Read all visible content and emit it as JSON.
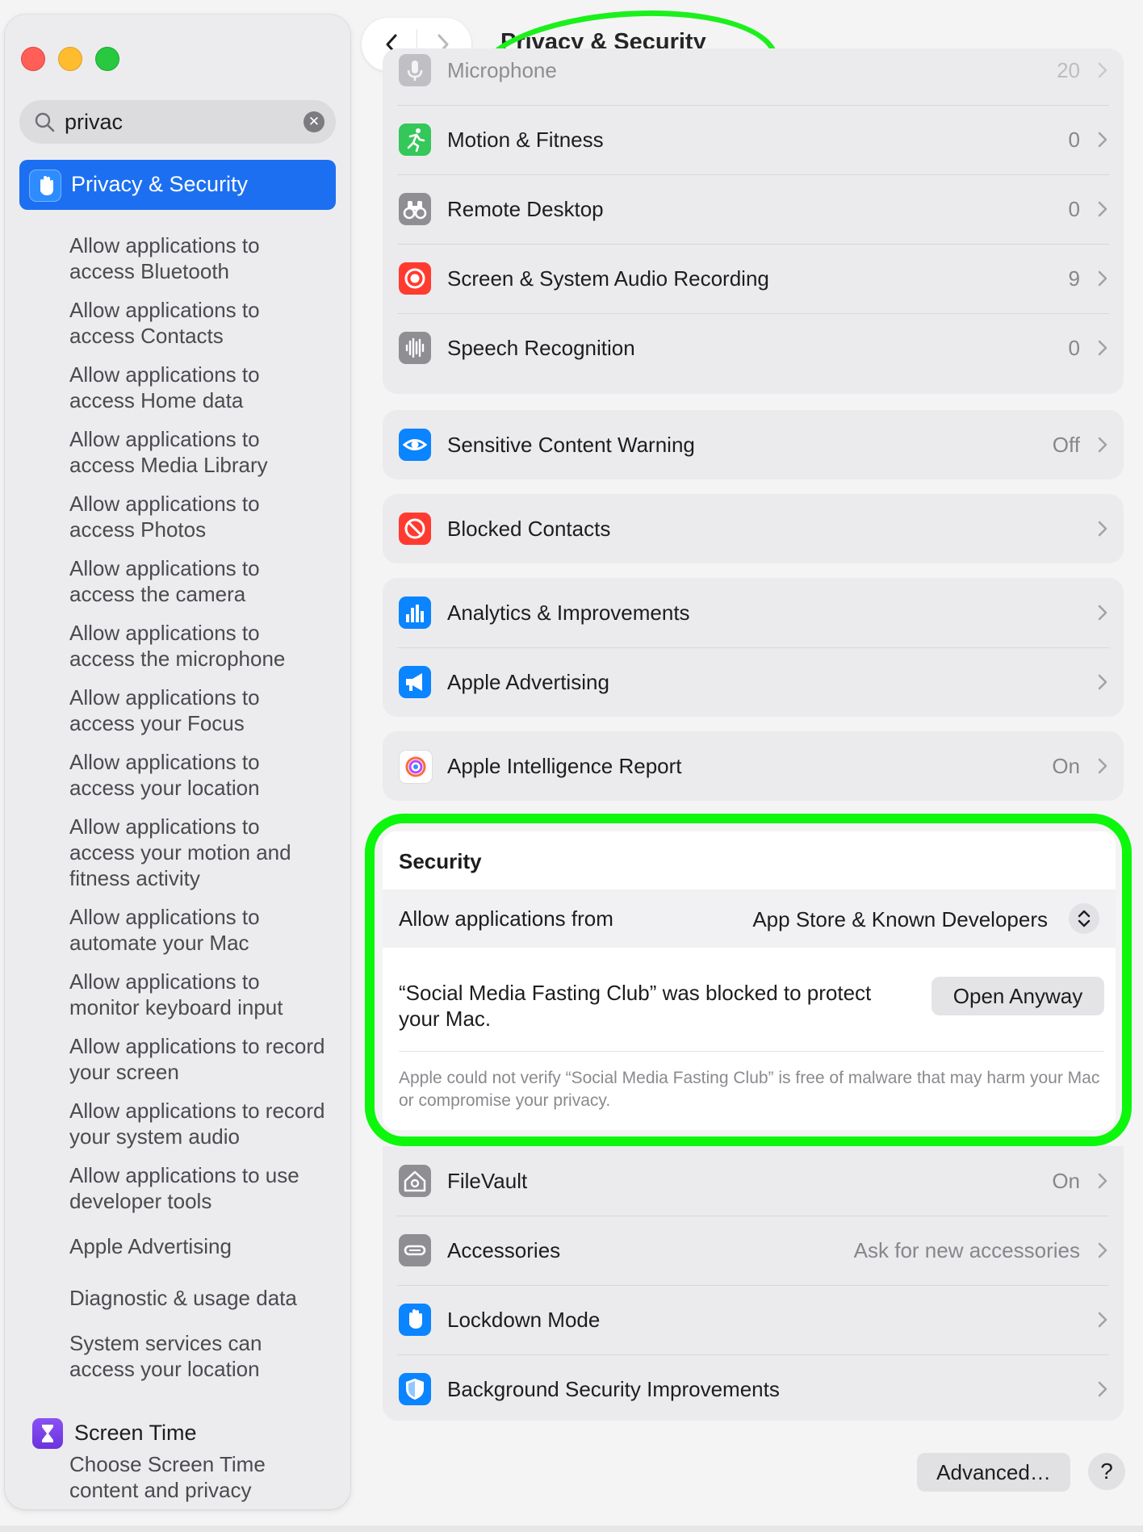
{
  "window": {
    "title": "Privacy & Security"
  },
  "sidebar": {
    "search_value": "privac",
    "selected_item": "Privacy & Security",
    "sub_items": [
      "Allow applications to access Bluetooth",
      "Allow applications to access Contacts",
      "Allow applications to access Home data",
      "Allow applications to access Media Library",
      "Allow applications to access Photos",
      "Allow applications to access the camera",
      "Allow applications to access the microphone",
      "Allow applications to access your Focus",
      "Allow applications to access your location",
      "Allow applications to access your motion and fitness activity",
      "Allow applications to automate your Mac",
      "Allow applications to monitor keyboard input",
      "Allow applications to record your screen",
      "Allow applications to record your system audio",
      "Allow applications to use developer tools",
      "Apple Advertising",
      "Diagnostic & usage data",
      "System services can access your location"
    ],
    "screen_time": "Screen Time",
    "screen_time_sub": "Choose Screen Time content and privacy"
  },
  "main": {
    "permissions": [
      {
        "label": "Microphone",
        "value": "20",
        "icon": "microphone-icon",
        "color": "#8e8e93"
      },
      {
        "label": "Motion & Fitness",
        "value": "0",
        "icon": "running-figure-icon",
        "color": "#34c759"
      },
      {
        "label": "Remote Desktop",
        "value": "0",
        "icon": "binoculars-icon",
        "color": "#8e8e93"
      },
      {
        "label": "Screen & System Audio Recording",
        "value": "9",
        "icon": "record-icon",
        "color": "#ff3b30"
      },
      {
        "label": "Speech Recognition",
        "value": "0",
        "icon": "waveform-icon",
        "color": "#8e8e93"
      }
    ],
    "sensitive": {
      "label": "Sensitive Content Warning",
      "value": "Off",
      "icon": "eye-warning-icon",
      "color": "#0a84ff"
    },
    "blocked": {
      "label": "Blocked Contacts",
      "value": "",
      "icon": "blocked-icon",
      "color": "#ff3b30"
    },
    "analytics": [
      {
        "label": "Analytics & Improvements",
        "value": "",
        "icon": "bar-chart-icon",
        "color": "#0a84ff"
      },
      {
        "label": "Apple Advertising",
        "value": "",
        "icon": "megaphone-icon",
        "color": "#0a84ff"
      }
    ],
    "intelligence": {
      "label": "Apple Intelligence Report",
      "value": "On",
      "icon": "apple-intelligence-icon"
    },
    "security": {
      "heading": "Security",
      "allow_label": "Allow applications from",
      "allow_value": "App Store & Known Developers",
      "blocked_message": "“Social Media Fasting Club” was blocked to protect your Mac.",
      "open_anyway": "Open Anyway",
      "note": "Apple could not verify “Social Media Fasting Club” is free of malware that may harm your Mac or compromise your privacy."
    },
    "security_items": [
      {
        "label": "FileVault",
        "value": "On",
        "icon": "house-lock-icon",
        "color": "#8e8e93"
      },
      {
        "label": "Accessories",
        "value": "Ask for new accessories",
        "icon": "accessory-icon",
        "color": "#8e8e93"
      },
      {
        "label": "Lockdown Mode",
        "value": "",
        "icon": "hand-icon",
        "color": "#0a84ff"
      },
      {
        "label": "Background Security Improvements",
        "value": "",
        "icon": "shield-icon",
        "color": "#0a84ff"
      }
    ],
    "advanced_button": "Advanced…",
    "help_button": "?"
  },
  "colors": {
    "accent": "#1c6ff0",
    "highlight": "#0cf70c"
  }
}
